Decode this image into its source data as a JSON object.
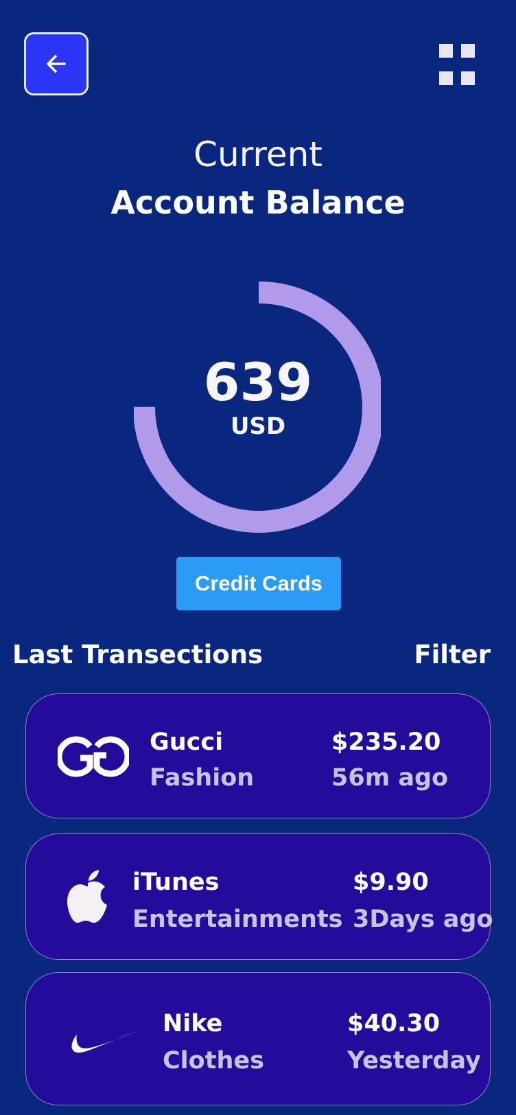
{
  "header": {
    "back_icon": "arrow-left-icon",
    "menu_icon": "grid-icon"
  },
  "balance": {
    "title_light": "Current",
    "title_bold": "Account Balance",
    "value": "639",
    "unit": "USD",
    "progress_fraction": 0.75,
    "ring_color": "#b09ae9"
  },
  "actions": {
    "credit_cards_label": "Credit Cards"
  },
  "transactions": {
    "title": "Last Transections",
    "filter_label": "Filter",
    "items": [
      {
        "logo": "gucci-logo",
        "name": "Gucci",
        "category": "Fashion",
        "amount": "$235.20",
        "time": "56m ago"
      },
      {
        "logo": "apple-logo",
        "name": "iTunes",
        "category": "Entertainments",
        "amount": "$9.90",
        "time": "3Days ago"
      },
      {
        "logo": "nike-logo",
        "name": "Nike",
        "category": "Clothes",
        "amount": "$40.30",
        "time": "Yesterday"
      }
    ]
  },
  "colors": {
    "background": "#09277e",
    "back_button": "#2b36f4",
    "card": "#250b9c",
    "accent_button": "#2c9af7",
    "muted_text": "#c9c3e2"
  }
}
